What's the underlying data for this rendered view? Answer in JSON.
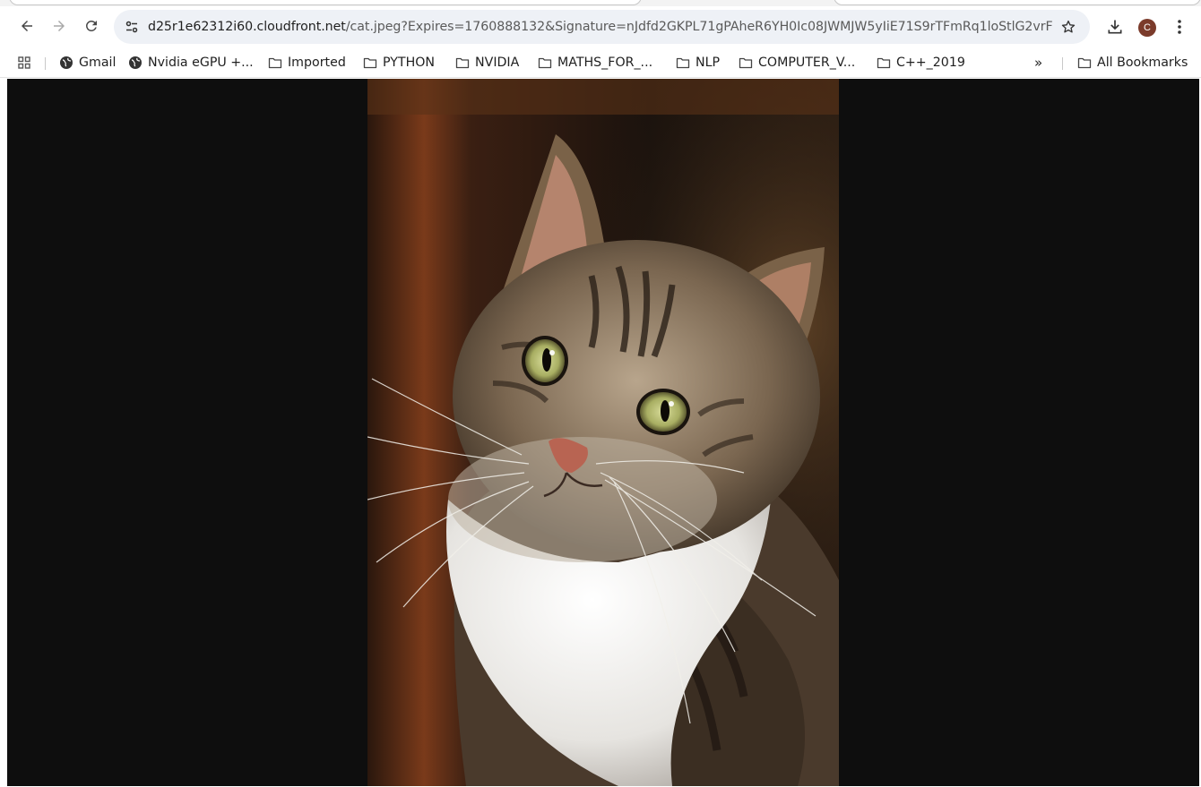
{
  "browser": {
    "url_host": "d25r1e62312i60.cloudfront.net",
    "url_path": "/cat.jpeg?Expires=1760888132&Signature=nJdfd2GKPL71gPAheR6YH0Ic08JWMJW5yIiE71S9rTFmRq1loStlG2vrF3a2MddVoU...",
    "profile_initial": "C"
  },
  "bookmarks": {
    "items": [
      {
        "label": "Gmail",
        "icon": "globe-icon"
      },
      {
        "label": "Nvidia eGPU +...",
        "icon": "globe-icon"
      },
      {
        "label": "Imported",
        "icon": "folder-icon"
      },
      {
        "label": "PYTHON",
        "icon": "folder-icon"
      },
      {
        "label": "NVIDIA",
        "icon": "folder-icon"
      },
      {
        "label": "MATHS_FOR_...",
        "icon": "folder-icon"
      },
      {
        "label": "NLP",
        "icon": "folder-icon"
      },
      {
        "label": "COMPUTER_V...",
        "icon": "folder-icon"
      },
      {
        "label": "C++_2019",
        "icon": "folder-icon"
      }
    ],
    "overflow": "»",
    "all_bookmarks": "All Bookmarks"
  },
  "colors": {
    "viewer_bg": "#0e0e0e",
    "omnibox_bg": "#eef1f6",
    "avatar_bg": "#7b3b2b"
  }
}
